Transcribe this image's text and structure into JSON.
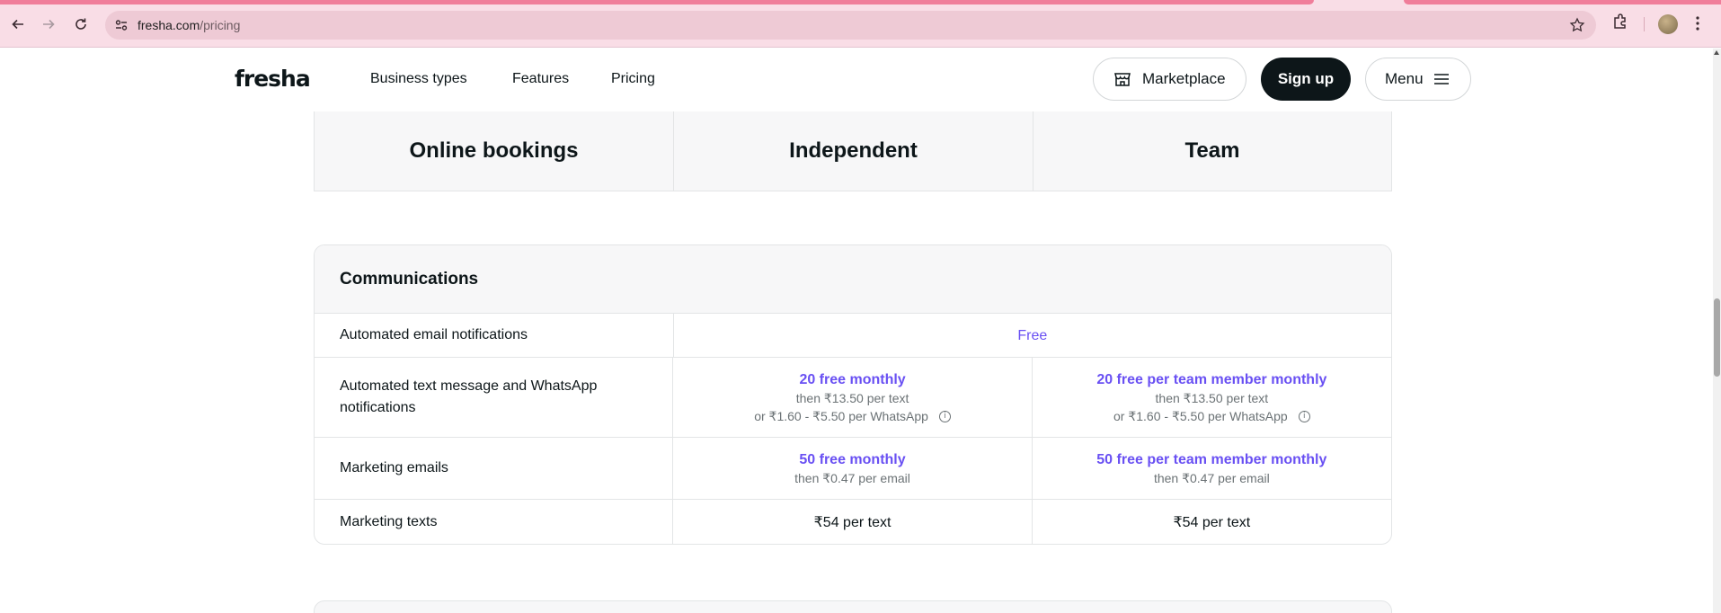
{
  "browser": {
    "url_host": "fresha.com",
    "url_path": "/pricing"
  },
  "header": {
    "logo": "fresha",
    "nav": [
      "Business types",
      "Features",
      "Pricing"
    ],
    "marketplace_label": "Marketplace",
    "signup_label": "Sign up",
    "menu_label": "Menu"
  },
  "plans": [
    "Online bookings",
    "Independent",
    "Team"
  ],
  "communications": {
    "title": "Communications",
    "rows": [
      {
        "label": "Automated email notifications",
        "shared": "Free"
      },
      {
        "label": "Automated text message and WhatsApp notifications",
        "independent": {
          "primary": "20 free monthly",
          "line1": "then ₹13.50 per text",
          "line2": "or ₹1.60 - ₹5.50 per WhatsApp"
        },
        "team": {
          "primary": "20 free per team member monthly",
          "line1": "then ₹13.50 per text",
          "line2": "or ₹1.60 - ₹5.50 per WhatsApp"
        }
      },
      {
        "label": "Marketing emails",
        "independent": {
          "primary": "50 free monthly",
          "line1": "then ₹0.47 per email"
        },
        "team": {
          "primary": "50 free per team member monthly",
          "line1": "then ₹0.47 per email"
        }
      },
      {
        "label": "Marketing texts",
        "independent": "₹54 per text",
        "team": "₹54 per text"
      }
    ]
  },
  "colors": {
    "accent": "#6950f3",
    "chrome": "#f9dde6",
    "dark_button": "#0d1619"
  }
}
